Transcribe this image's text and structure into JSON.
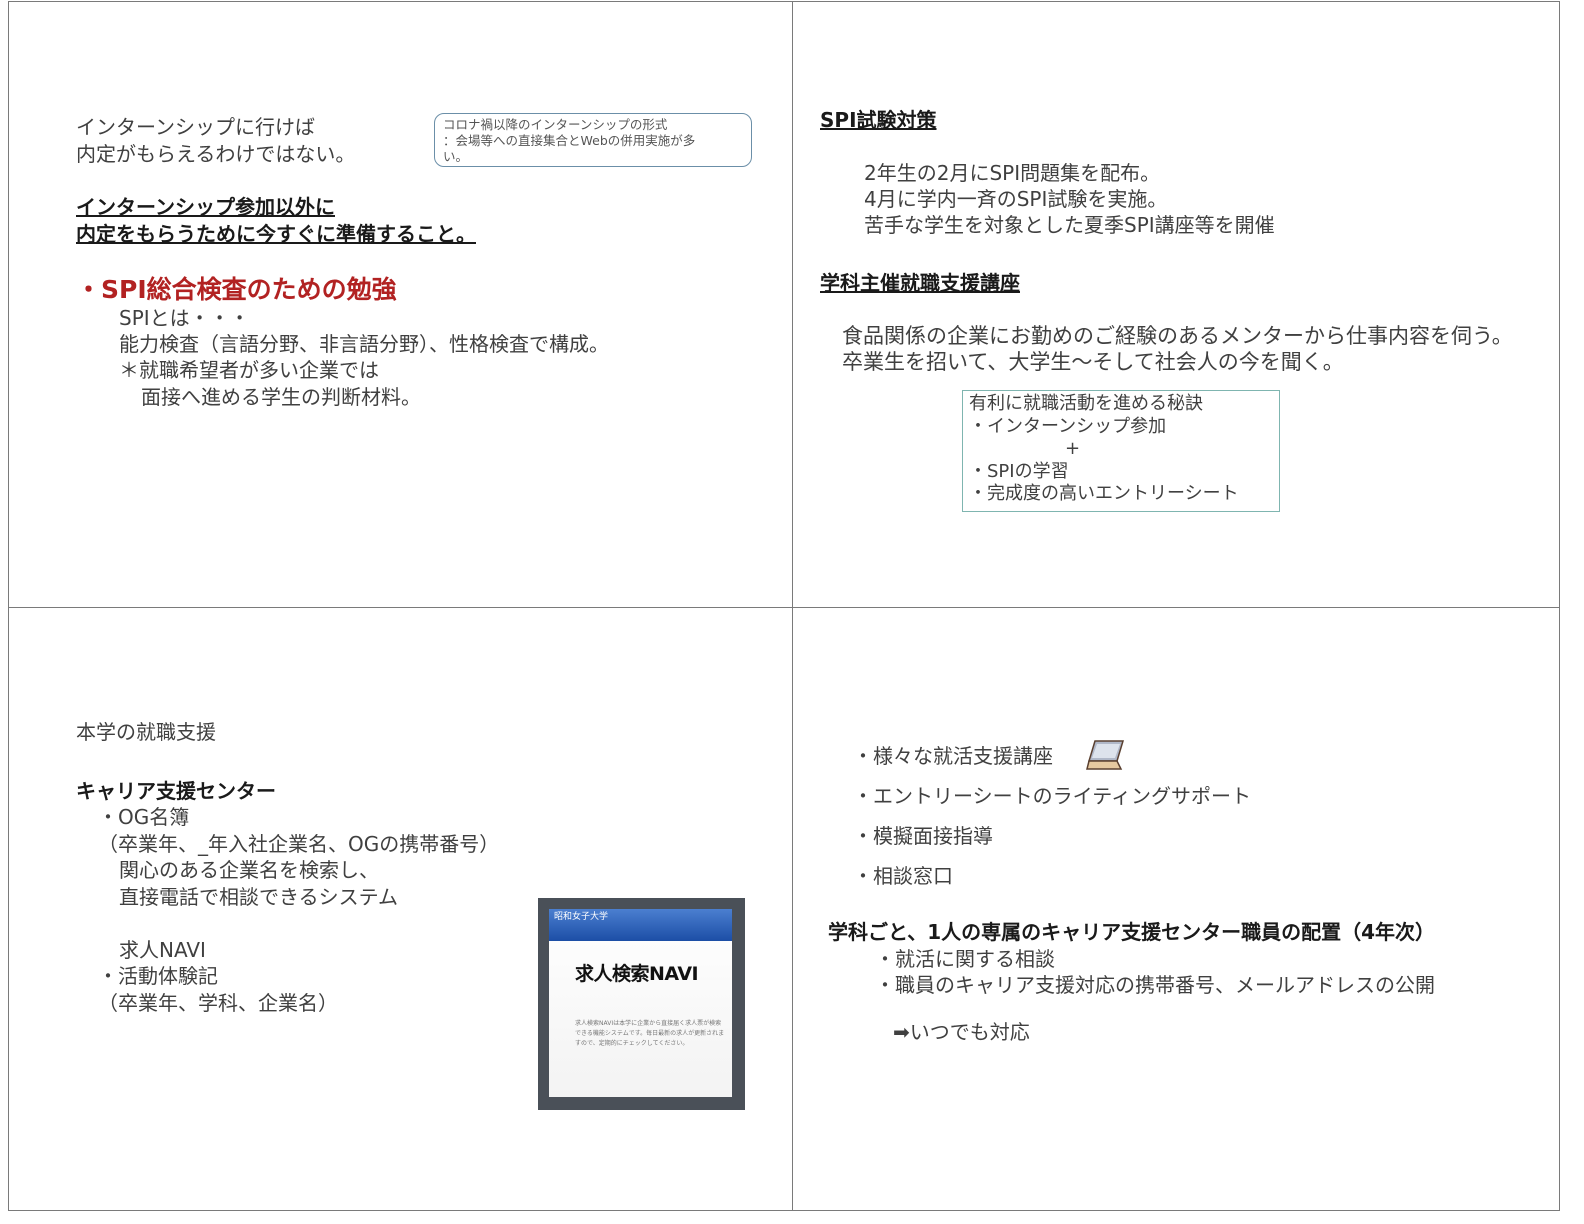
{
  "panel1": {
    "lead_line1": "インターンシップに行けば",
    "lead_line2": "内定がもらえるわけではない。",
    "callout_line1": "コロナ禍以降のインターンシップの形式",
    "callout_line2": "：会場等への直接集合とWebの併用実施が多",
    "callout_line3": "い。",
    "heading_line1": "インターンシップ参加以外に",
    "heading_line2": "内定をもらうために今すぐに準備すること。",
    "red_title": "・SPI総合検査のための勉強",
    "body_line1": "SPIとは・・・",
    "body_line2": "能力検査（言語分野、非言語分野）、性格検査で構成。",
    "body_line3": "＊就職希望者が多い企業では",
    "body_line4": "面接へ進める学生の判断材料。"
  },
  "panel2": {
    "spi_heading": "SPI試験対策",
    "spi_line1": "2年生の2月にSPI問題集を配布。",
    "spi_line2": "4月に学内一斉のSPI試験を実施。",
    "spi_line3": "苦手な学生を対象とした夏季SPI講座等を開催",
    "dept_heading": "学科主催就職支援講座",
    "dept_line1": "食品関係の企業にお勤めのご経験のあるメンターから仕事内容を伺う。",
    "dept_line2": "卒業生を招いて、大学生～そして社会人の今を聞く。",
    "box_line1": "有利に就職活動を進める秘訣",
    "box_line2": "・インターンシップ参加",
    "box_line3": "+",
    "box_line4": "・SPIの学習",
    "box_line5": "・完成度の高いエントリーシート"
  },
  "panel3": {
    "title": "本学の就職支援",
    "center_heading": "キャリア支援センター",
    "line1": "・OG名簿",
    "line2": "（卒業年、_年入社企業名、OGの携帯番号）",
    "line3": "関心のある企業名を検索し、",
    "line4": "直接電話で相談できるシステム",
    "line5": "求人NAVI",
    "line6": "・活動体験記",
    "line7": "（卒業年、学科、企業名）",
    "navi_bar": "昭和女子大学",
    "navi_title": "求人検索NAVI",
    "navi_text": "求人検索NAVIは本学に企業から直接届く求人票が検索できる機能システムです。毎日最新の求人が更新されますので、定期的にチェックしてください。"
  },
  "panel4": {
    "item1": "・様々な就活支援講座",
    "item2": "・エントリーシートのライティングサポート",
    "item3": "・模擬面接指導",
    "item4": "・相談窓口",
    "heading": "学科ごと、1人の専属のキャリア支援センター職員の配置（4年次）",
    "sub1": "・就活に関する相談",
    "sub2": "・職員のキャリア支援対応の携帯番号、メールアドレスの公開",
    "sub3": "➡いつでも対応",
    "laptop_icon": "laptop-icon"
  }
}
